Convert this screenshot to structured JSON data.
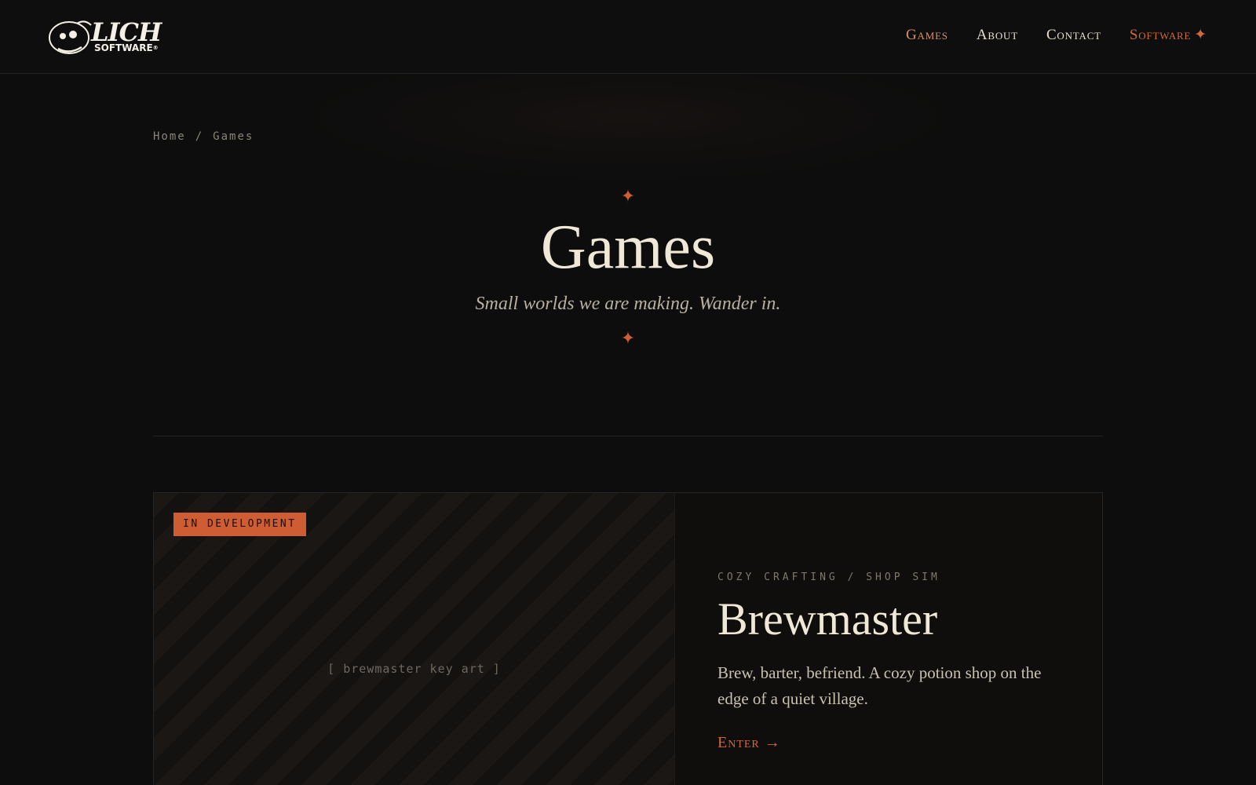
{
  "header": {
    "logo": {
      "word": "LICH",
      "sub": "SOFTWARE",
      "mark": "®"
    },
    "nav": [
      {
        "label": "Games",
        "state": "active"
      },
      {
        "label": "About",
        "state": "default"
      },
      {
        "label": "Contact",
        "state": "default"
      },
      {
        "label": "Software",
        "state": "accent",
        "suffix": "✦"
      }
    ]
  },
  "breadcrumb": {
    "home": "Home",
    "separator": "/",
    "current": "Games"
  },
  "hero": {
    "ornament": "✦",
    "title": "Games",
    "subtitle": "Small worlds we are making. Wander in."
  },
  "games": [
    {
      "status": "IN DEVELOPMENT",
      "art_placeholder": "[ brewmaster key art ]",
      "genre": "COZY CRAFTING / SHOP SIM",
      "title": "Brewmaster",
      "description": "Brew, barter, befriend. A cozy potion shop on the edge of a quiet village.",
      "cta": "Enter →"
    }
  ],
  "colors": {
    "background": "#0d0d0d",
    "text": "#ece6d6",
    "accent": "#cf5d33",
    "nav_active": "#d89160",
    "muted": "#8a857a"
  }
}
